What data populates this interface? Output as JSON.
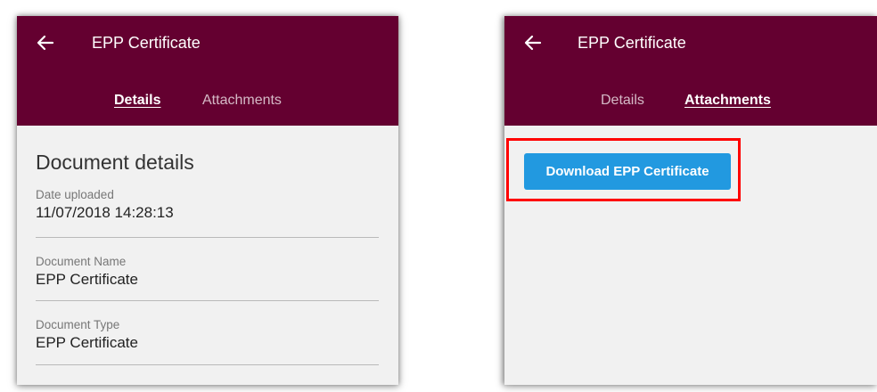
{
  "left_screen": {
    "title": "EPP Certificate",
    "back_icon": "arrow-left-icon",
    "tabs": [
      {
        "label": "Details",
        "active": true
      },
      {
        "label": "Attachments",
        "active": false
      }
    ],
    "heading": "Document details",
    "fields": [
      {
        "label": "Date uploaded",
        "value": "11/07/2018 14:28:13"
      },
      {
        "label": "Document Name",
        "value": "EPP Certificate"
      },
      {
        "label": "Document Type",
        "value": "EPP Certificate"
      }
    ]
  },
  "right_screen": {
    "title": "EPP Certificate",
    "back_icon": "arrow-left-icon",
    "tabs": [
      {
        "label": "Details",
        "active": false
      },
      {
        "label": "Attachments",
        "active": true
      }
    ],
    "download_button": "Download EPP Certificate"
  },
  "colors": {
    "appbar": "#640030",
    "button": "#2299e0",
    "highlight": "#ff0000",
    "background": "#f1f1f1"
  }
}
